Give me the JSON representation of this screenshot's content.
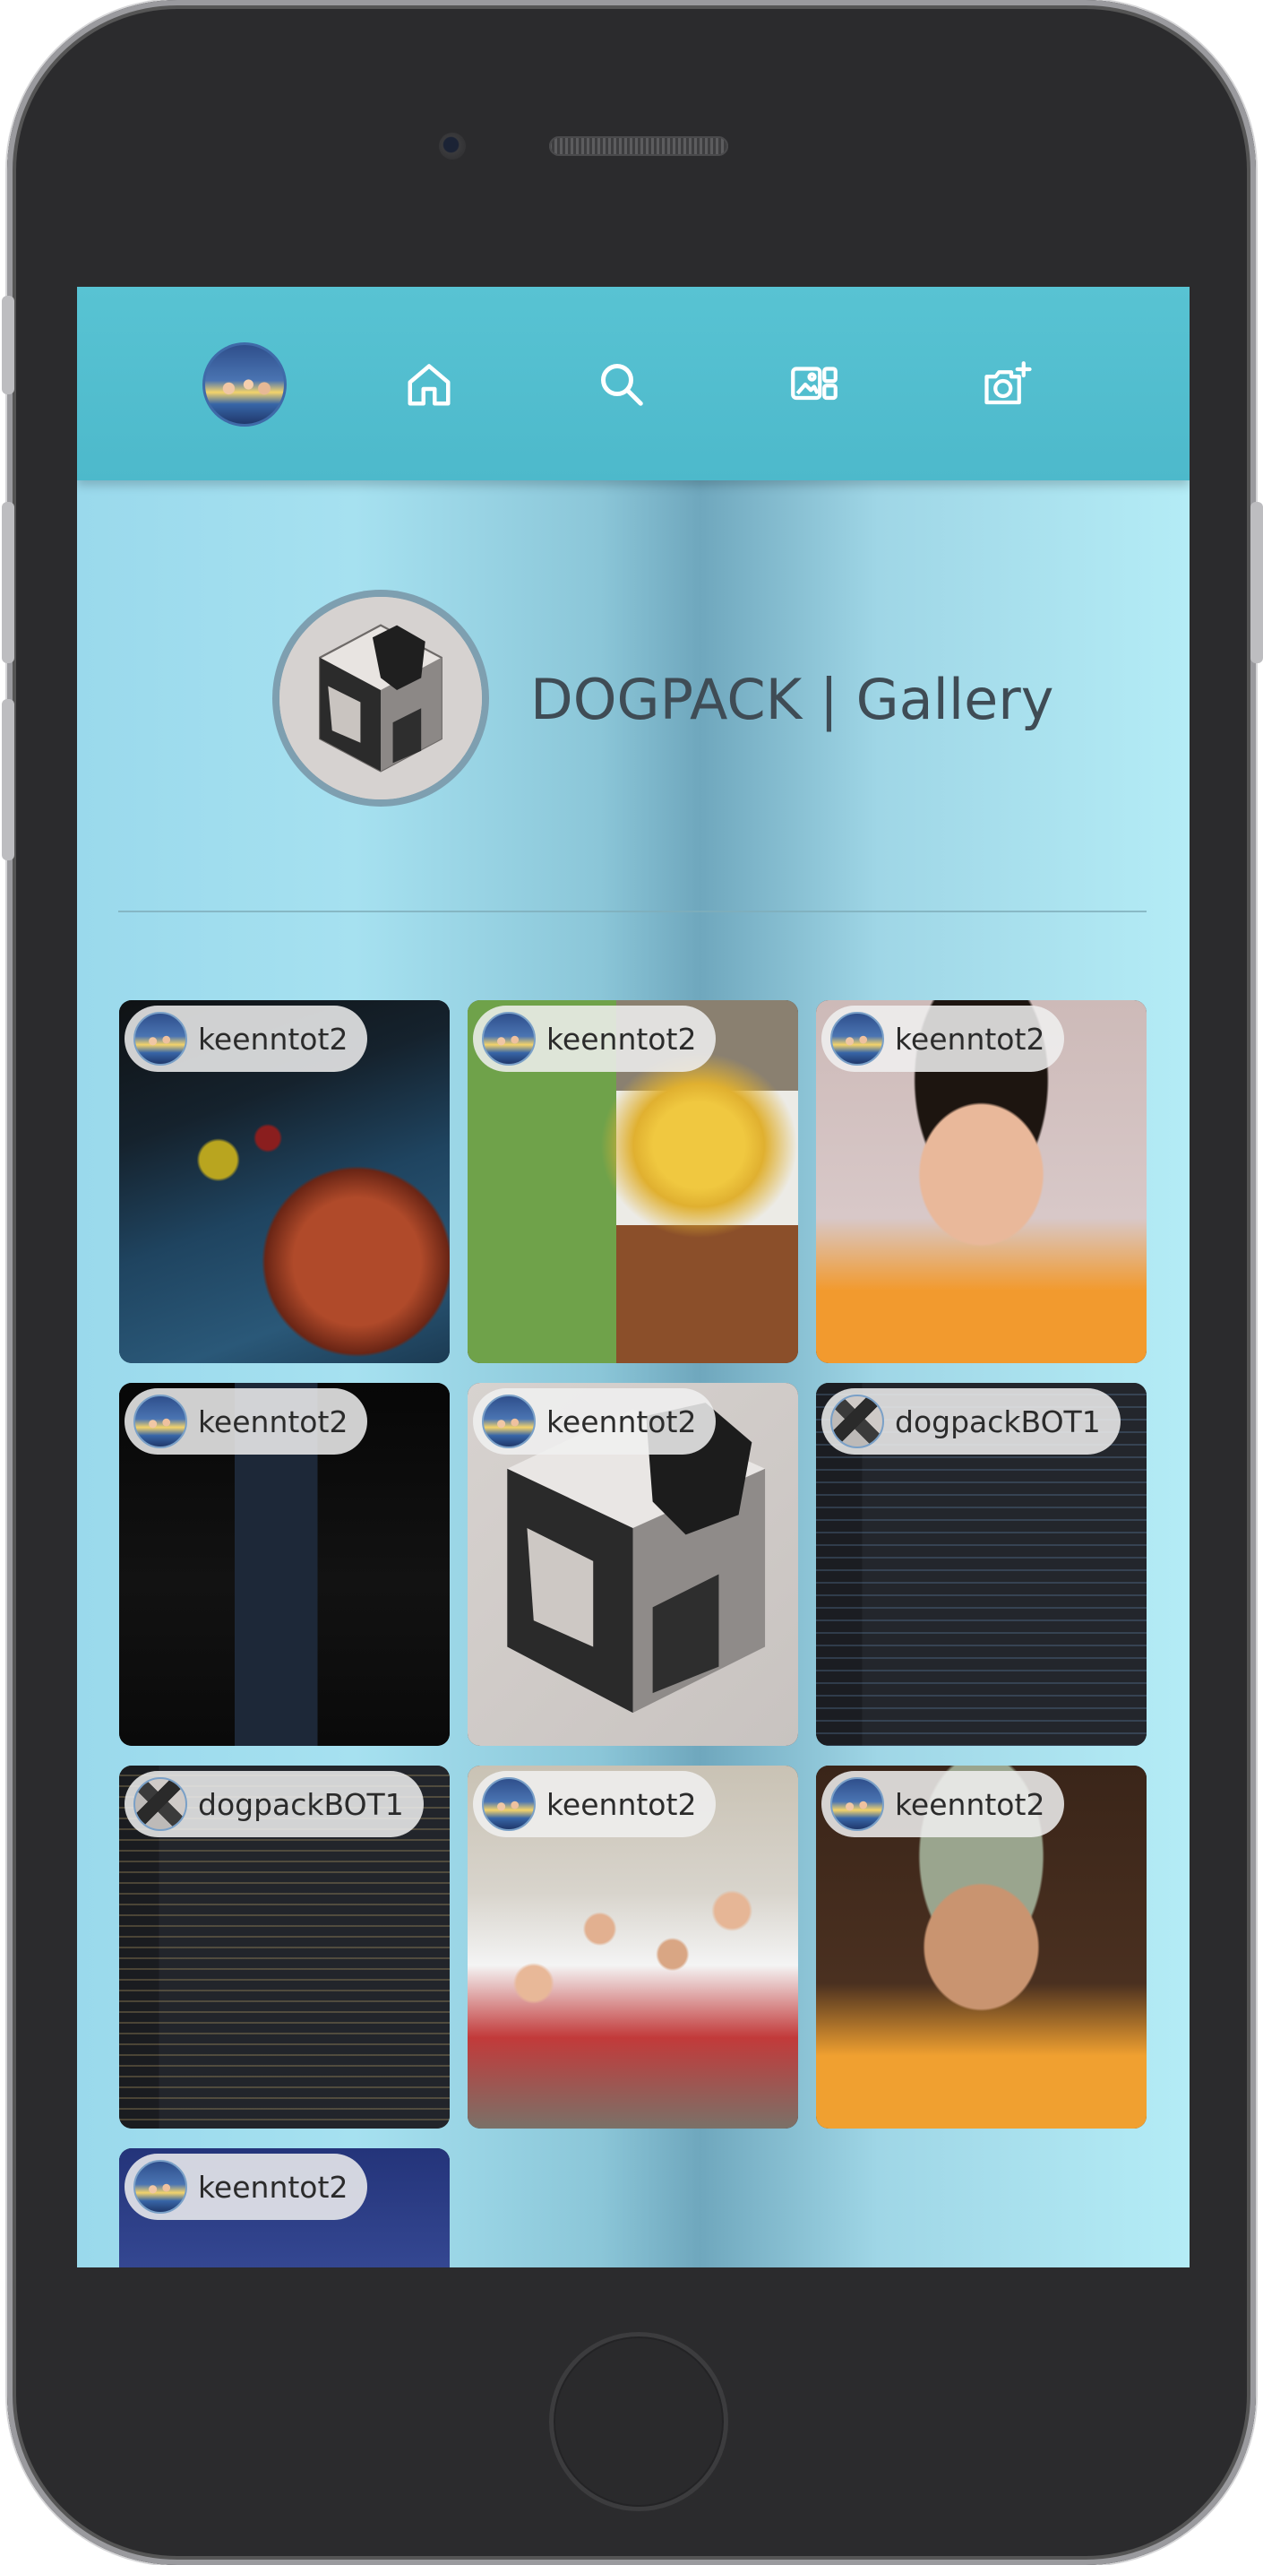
{
  "header": {
    "title": "DOGPACK | Gallery"
  },
  "nav": {
    "items": [
      {
        "icon": "avatar"
      },
      {
        "icon": "home-icon"
      },
      {
        "icon": "search-icon"
      },
      {
        "icon": "gallery-icon"
      },
      {
        "icon": "add-photo-icon"
      }
    ]
  },
  "posts": [
    {
      "user": "keenntot2",
      "image": "billiards"
    },
    {
      "user": "keenntot2",
      "image": "milk-tea-and-fries"
    },
    {
      "user": "keenntot2",
      "image": "selfie"
    },
    {
      "user": "keenntot2",
      "image": "desk-setup"
    },
    {
      "user": "keenntot2",
      "image": "dogpack-logo"
    },
    {
      "user": "dogpackBOT1",
      "image": "code-editor"
    },
    {
      "user": "dogpackBOT1",
      "image": "code-editor"
    },
    {
      "user": "keenntot2",
      "image": "group-photo"
    },
    {
      "user": "keenntot2",
      "image": "selfie-cap"
    },
    {
      "user": "keenntot2",
      "image": "ceiling-lights"
    }
  ]
}
